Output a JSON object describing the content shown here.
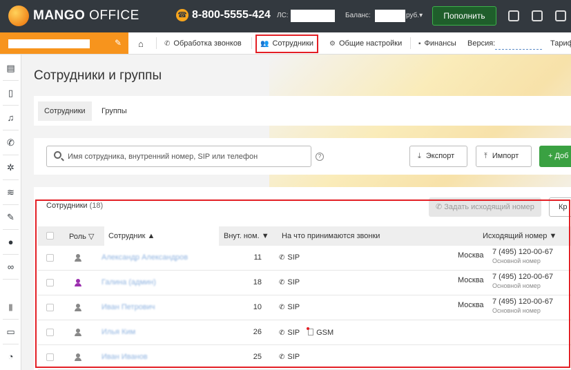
{
  "topbar": {
    "logo_bold": "MANGO",
    "logo_light": " OFFICE",
    "phone": "8-800-5555-424",
    "ls_label": "ЛС:",
    "balance_label": "Баланс:",
    "balance_currency": "руб.▾",
    "topup_label": "Пополнить"
  },
  "nav": {
    "items": [
      {
        "label": "Обработка звонков",
        "icon": "phone-icon"
      },
      {
        "label": "Сотрудники",
        "icon": "users-icon"
      },
      {
        "label": "Общие настройки",
        "icon": "gear-icon"
      },
      {
        "label": "Финансы",
        "icon": "wallet-icon"
      }
    ],
    "version_label": "Версия:",
    "tariff_label": "Тариф"
  },
  "page": {
    "title": "Сотрудники и группы",
    "tabs": [
      {
        "label": "Сотрудники"
      },
      {
        "label": "Группы"
      }
    ]
  },
  "search": {
    "placeholder": "Имя сотрудника, внутренний номер, SIP или телефон",
    "help": "?",
    "export_label": "Экспорт",
    "import_label": "Импорт",
    "add_label": "+ Доб"
  },
  "employees": {
    "title": "Сотрудники",
    "count": "(18)",
    "outgoing_button": "Задать исходящий номер",
    "cr_button": "Кр",
    "columns": {
      "role": "Роль",
      "employee": "Сотрудник",
      "ext": "Внут. ном.",
      "receives": "На что принимаются звонки",
      "outgoing": "Исходящий номер"
    },
    "rows": [
      {
        "name": "Александр Александров",
        "role_color": "#888888",
        "ext": "11",
        "receives": [
          "SIP"
        ],
        "city": "Москва",
        "number": "7 (495) 120-00-67",
        "number_sub": "Основной номер"
      },
      {
        "name": "Галина (админ)",
        "role_color": "#9b2fae",
        "ext": "18",
        "receives": [
          "SIP"
        ],
        "city": "Москва",
        "number": "7 (495) 120-00-67",
        "number_sub": "Основной номер"
      },
      {
        "name": "Иван Петрович",
        "role_color": "#888888",
        "ext": "10",
        "receives": [
          "SIP"
        ],
        "city": "Москва",
        "number": "7 (495) 120-00-67",
        "number_sub": "Основной номер"
      },
      {
        "name": "Илья Ким",
        "role_color": "#888888",
        "ext": "26",
        "receives": [
          "SIP",
          "GSM"
        ],
        "city": "",
        "number": "",
        "number_sub": ""
      },
      {
        "name": "Иван Иванов",
        "role_color": "#888888",
        "ext": "25",
        "receives": [
          "SIP"
        ],
        "city": "",
        "number": "",
        "number_sub": ""
      }
    ]
  },
  "colors": {
    "topbar": "#33393f",
    "accent_orange": "#f7941d",
    "highlight_red": "#e31e24",
    "add_green": "#3aa142",
    "admin_purple": "#9b2fae"
  }
}
